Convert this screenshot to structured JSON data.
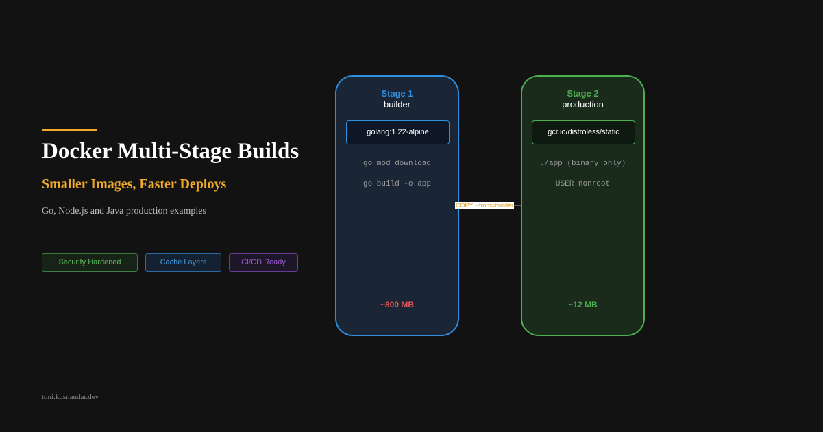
{
  "colors": {
    "background": "#121212",
    "accent": "#f0a928",
    "stage1": "#2f8fe0",
    "stage2": "#4caf50",
    "cicd": "#8e44d0",
    "size_large": "#e05555"
  },
  "title": "Docker Multi-Stage Builds",
  "subtitle": "Smaller Images, Faster Deploys",
  "description": "Go, Node.js and Java production examples",
  "badges": [
    {
      "label": "Security Hardened"
    },
    {
      "label": "Cache Layers"
    },
    {
      "label": "CI/CD Ready"
    }
  ],
  "footer": "toni.kusnandar.dev",
  "stages": [
    {
      "number": "Stage 1",
      "name": "builder",
      "image": "golang:1.22-alpine",
      "commands": [
        "go mod download",
        "go build -o app"
      ],
      "size": "~800 MB"
    },
    {
      "number": "Stage 2",
      "name": "production",
      "image": "gcr.io/distroless/static",
      "commands": [
        "./app (binary only)",
        "USER nonroot"
      ],
      "size": "~12 MB"
    }
  ],
  "copy_label": "COPY --from=builder"
}
